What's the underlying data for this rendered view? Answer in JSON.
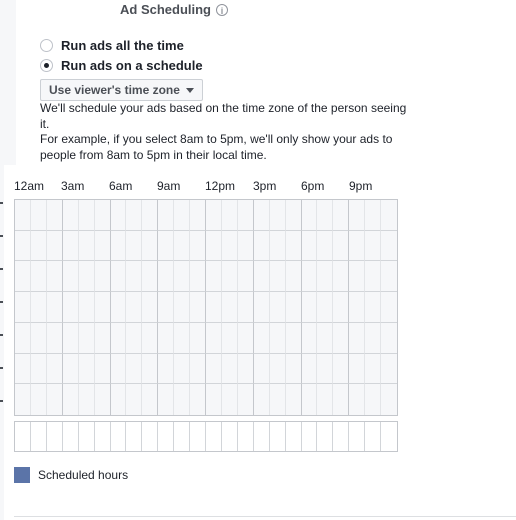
{
  "section": {
    "title": "Ad Scheduling",
    "info_icon": "i"
  },
  "options": {
    "all_time": {
      "label": "Run ads all the time",
      "selected": false
    },
    "schedule": {
      "label": "Run ads on a schedule",
      "selected": true
    }
  },
  "timezone_dropdown": {
    "selected": "Use viewer's time zone"
  },
  "description": {
    "line1": "We'll schedule your ads based on the time zone of the person seeing it.",
    "line2": "For example, if you select 8am to 5pm, we'll only show your ads to people from 8am to 5pm in their local time."
  },
  "hour_labels": [
    "12am",
    "3am",
    "6am",
    "9am",
    "12pm",
    "3pm",
    "6pm",
    "9pm"
  ],
  "legend": {
    "label": "Scheduled hours",
    "color": "#5b74a8"
  }
}
